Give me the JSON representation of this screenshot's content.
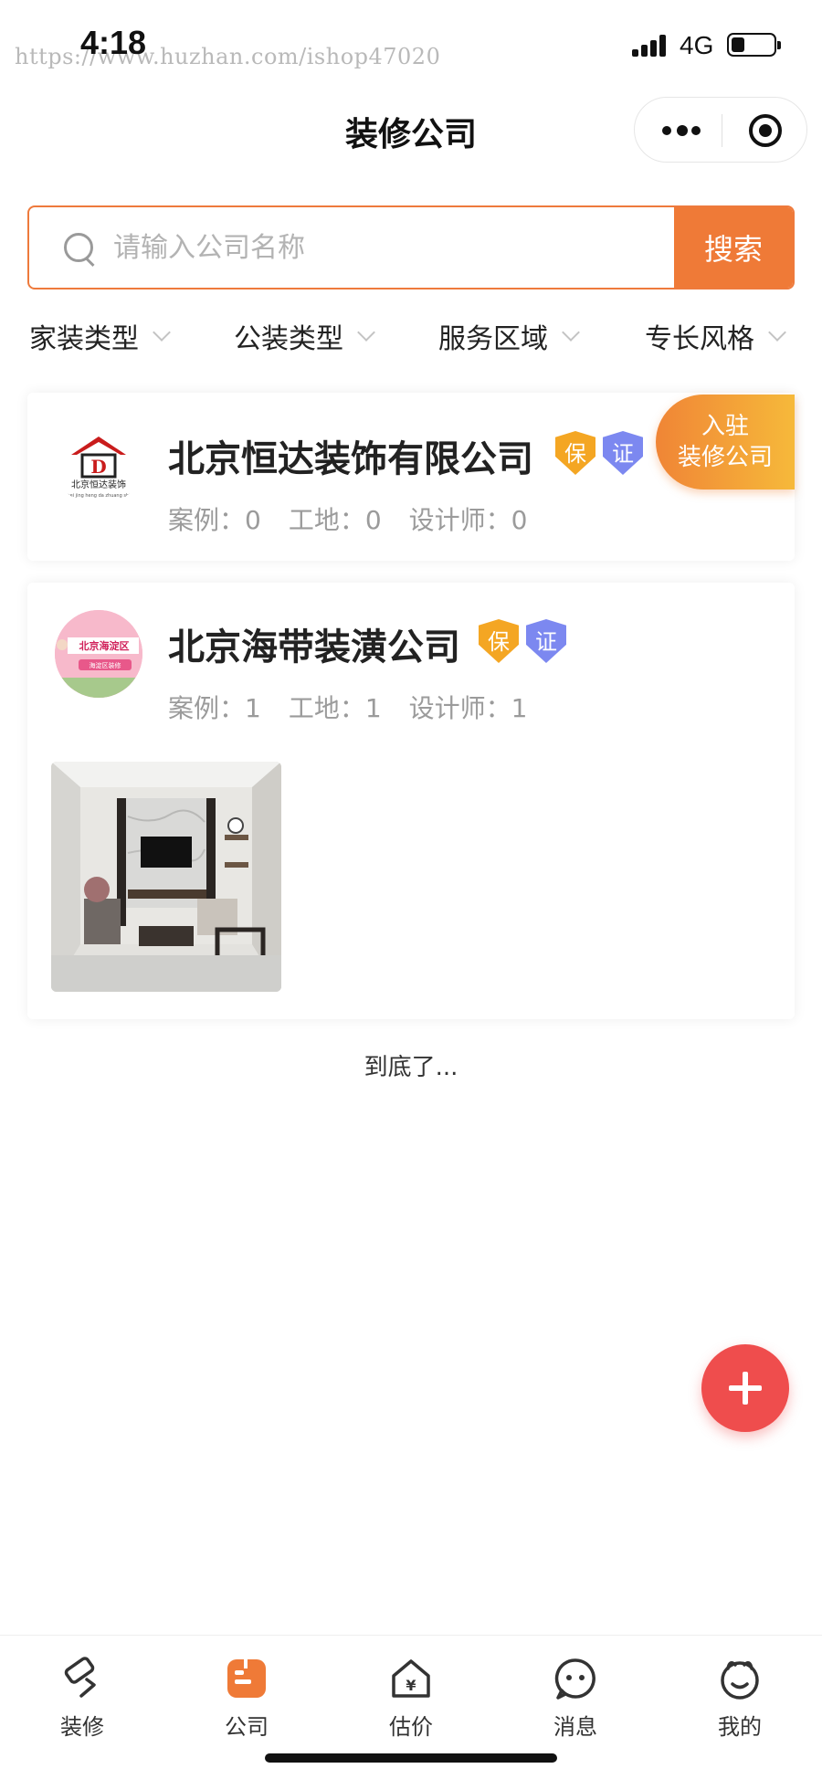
{
  "watermark": "https://www.huzhan.com/ishop47020",
  "status_bar": {
    "time": "4:18",
    "network": "4G"
  },
  "nav": {
    "title": "装修公司"
  },
  "search": {
    "placeholder": "请输入公司名称",
    "value": "",
    "button_label": "搜索"
  },
  "filters": [
    {
      "label": "家装类型"
    },
    {
      "label": "公装类型"
    },
    {
      "label": "服务区域"
    },
    {
      "label": "专长风格"
    }
  ],
  "companies": [
    {
      "name": "北京恒达装饰有限公司",
      "badges": [
        "保",
        "证"
      ],
      "stats": {
        "cases": "案例：0",
        "sites": "工地：0",
        "designers": "设计师：0"
      },
      "logo_text": "北京恒达装饰",
      "logo_subtext": "bei jing heng da zhuang shi",
      "logo_letter": "D"
    },
    {
      "name": "北京海带装潢公司",
      "badges": [
        "保",
        "证"
      ],
      "stats": {
        "cases": "案例：1",
        "sites": "工地：1",
        "designers": "设计师：1"
      },
      "logo_text": "北京海淀区",
      "logo_subtext": "海淀区装修"
    }
  ],
  "join_button": {
    "line1": "入驻",
    "line2": "装修公司"
  },
  "end_text": "到底了...",
  "tabs": [
    {
      "label": "装修",
      "icon": "paint-roller-icon"
    },
    {
      "label": "公司",
      "icon": "company-icon",
      "active": true
    },
    {
      "label": "估价",
      "icon": "price-house-icon"
    },
    {
      "label": "消息",
      "icon": "message-face-icon"
    },
    {
      "label": "我的",
      "icon": "profile-face-icon"
    }
  ],
  "colors": {
    "accent": "#ef7a37",
    "badge_bao": "#f4a623",
    "badge_zheng": "#7c88f0",
    "fab": "#ef4d4d"
  }
}
